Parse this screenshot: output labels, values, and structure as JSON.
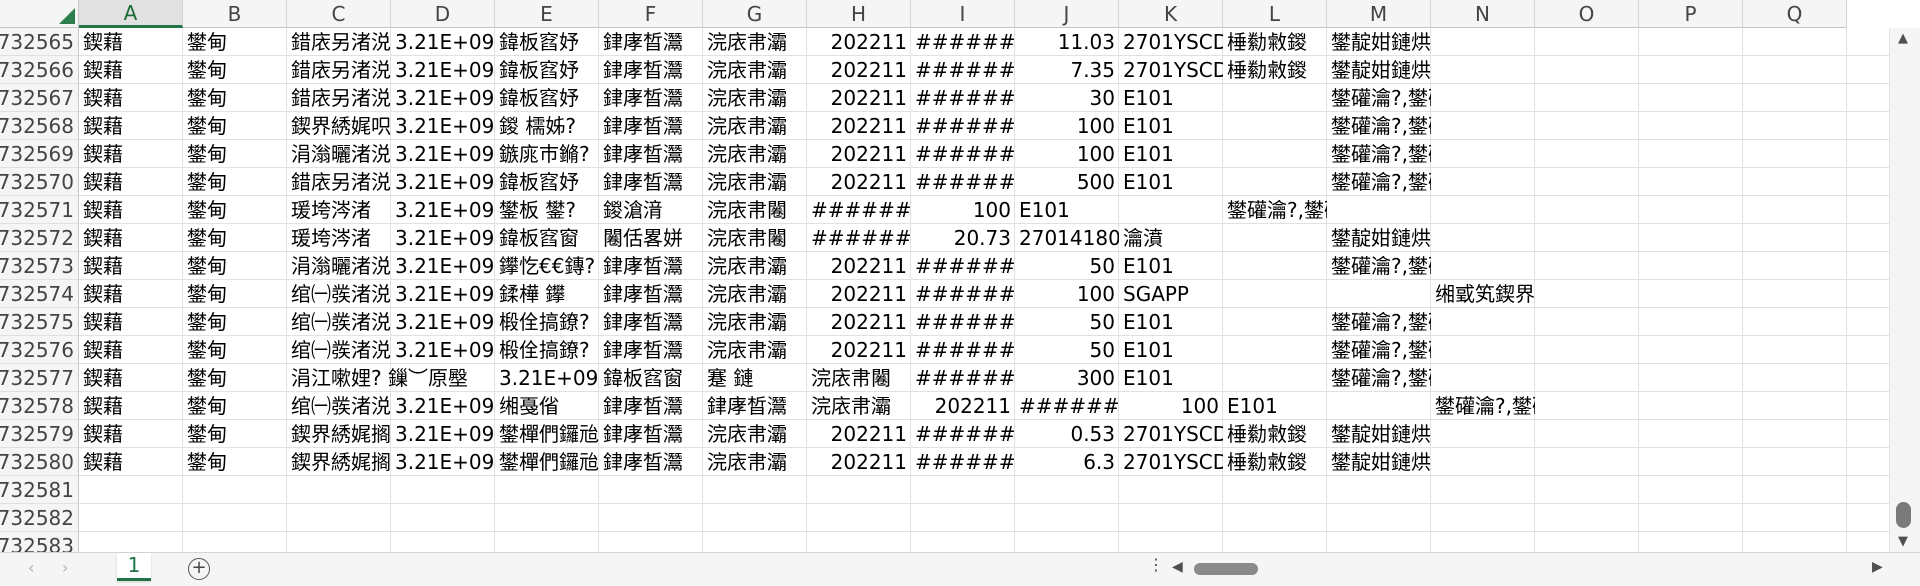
{
  "sheet": {
    "columns": [
      "A",
      "B",
      "C",
      "D",
      "E",
      "F",
      "G",
      "H",
      "I",
      "J",
      "K",
      "L",
      "M",
      "N",
      "O",
      "P",
      "Q"
    ],
    "selected_column": "A",
    "row_numbers": [
      "732565",
      "732566",
      "732567",
      "732568",
      "732569",
      "732570",
      "732571",
      "732572",
      "732573",
      "732574",
      "732575",
      "732576",
      "732577",
      "732578",
      "732579",
      "732580",
      "732581",
      "732582",
      "732583"
    ],
    "rows": [
      [
        {
          "col": "A",
          "v": "鍥藉"
        },
        {
          "col": "B",
          "v": "鐢甸"
        },
        {
          "col": "C",
          "v": "錯庡另渚涚"
        },
        {
          "col": "D",
          "v": "3.21E+09",
          "a": "r"
        },
        {
          "col": "E",
          "v": "鍏板窞妤"
        },
        {
          "col": "F",
          "v": "銉庨晳灊"
        },
        {
          "col": "G",
          "v": "浣庡帇灞"
        },
        {
          "col": "H",
          "v": "202211",
          "a": "r"
        },
        {
          "col": "I",
          "v": "#######"
        },
        {
          "col": "J",
          "v": "11.03",
          "a": "r"
        },
        {
          "col": "K",
          "v": "2701YSCD"
        },
        {
          "col": "L",
          "v": "棰勬敹鍐"
        },
        {
          "col": "M",
          "v": "鐢靛姏鏈烘澧炲€煎"
        }
      ],
      [
        {
          "col": "A",
          "v": "鍥藉"
        },
        {
          "col": "B",
          "v": "鐢甸"
        },
        {
          "col": "C",
          "v": "錯庡另渚涚"
        },
        {
          "col": "D",
          "v": "3.21E+09",
          "a": "r"
        },
        {
          "col": "E",
          "v": "鍏板窞妤"
        },
        {
          "col": "F",
          "v": "銉庨晳灊"
        },
        {
          "col": "G",
          "v": "浣庡帇灞"
        },
        {
          "col": "H",
          "v": "202211",
          "a": "r"
        },
        {
          "col": "I",
          "v": "#######"
        },
        {
          "col": "J",
          "v": "7.35",
          "a": "r"
        },
        {
          "col": "K",
          "v": "2701YSCD"
        },
        {
          "col": "L",
          "v": "棰勬敹鍐"
        },
        {
          "col": "M",
          "v": "鐢靛姏鏈烘澧炲€煎"
        }
      ],
      [
        {
          "col": "A",
          "v": "鍥藉"
        },
        {
          "col": "B",
          "v": "鐢甸"
        },
        {
          "col": "C",
          "v": "錯庡另渚涚"
        },
        {
          "col": "D",
          "v": "3.21E+09",
          "a": "r"
        },
        {
          "col": "E",
          "v": "鍏板窞妤"
        },
        {
          "col": "F",
          "v": "銉庨晳灊"
        },
        {
          "col": "G",
          "v": "浣庡帇灞"
        },
        {
          "col": "H",
          "v": "202211",
          "a": "r"
        },
        {
          "col": "I",
          "v": "#######"
        },
        {
          "col": "J",
          "v": "30",
          "a": "r"
        },
        {
          "col": "K",
          "v": "E101"
        },
        {
          "col": "M",
          "v": "鐢礶瀹?,鐢礶瀹?寰    俊\""
        }
      ],
      [
        {
          "col": "A",
          "v": "鍥藉"
        },
        {
          "col": "B",
          "v": "鐢甸"
        },
        {
          "col": "C",
          "v": "鍥界綉娓呮"
        },
        {
          "col": "D",
          "v": "3.21E+09",
          "a": "r"
        },
        {
          "col": "E",
          "v": "鍐    檽姊?"
        },
        {
          "col": "F",
          "v": "銉庨晳灊"
        },
        {
          "col": "G",
          "v": "浣庡帇灞"
        },
        {
          "col": "H",
          "v": "202211",
          "a": "r"
        },
        {
          "col": "I",
          "v": "#######"
        },
        {
          "col": "J",
          "v": "100",
          "a": "r"
        },
        {
          "col": "K",
          "v": "E101"
        },
        {
          "col": "M",
          "v": "鐢礶瀹?,鐢礶瀹?寰    俊\""
        }
      ],
      [
        {
          "col": "A",
          "v": "鍥藉"
        },
        {
          "col": "B",
          "v": "鐢甸"
        },
        {
          "col": "C",
          "v": "涓滃曬渚涚"
        },
        {
          "col": "D",
          "v": "3.21E+09",
          "a": "r"
        },
        {
          "col": "E",
          "v": "鏃庣巿鏅?"
        },
        {
          "col": "F",
          "v": "銉庨晳灊"
        },
        {
          "col": "G",
          "v": "浣庡帇灞"
        },
        {
          "col": "H",
          "v": "202211",
          "a": "r"
        },
        {
          "col": "I",
          "v": "#######"
        },
        {
          "col": "J",
          "v": "100",
          "a": "r"
        },
        {
          "col": "K",
          "v": "E101"
        },
        {
          "col": "M",
          "v": "鐢礶瀹?,鐢礶瀹?寰    俊\""
        }
      ],
      [
        {
          "col": "A",
          "v": "鍥藉"
        },
        {
          "col": "B",
          "v": "鐢甸"
        },
        {
          "col": "C",
          "v": "錯庡另渚涚"
        },
        {
          "col": "D",
          "v": "3.21E+09",
          "a": "r"
        },
        {
          "col": "E",
          "v": "鍏板窞妤"
        },
        {
          "col": "F",
          "v": "銉庨晳灊"
        },
        {
          "col": "G",
          "v": "浣庡帇灞"
        },
        {
          "col": "H",
          "v": "202211",
          "a": "r"
        },
        {
          "col": "I",
          "v": "#######"
        },
        {
          "col": "J",
          "v": "500",
          "a": "r"
        },
        {
          "col": "K",
          "v": "E101"
        },
        {
          "col": "M",
          "v": "鐢礶瀹?,鐢礶瀹?寰    俊\""
        }
      ],
      [
        {
          "col": "A",
          "v": "鍥藉"
        },
        {
          "col": "B",
          "v": "鐢甸"
        },
        {
          "col": "C",
          "v": "瑗垮涔渚"
        },
        {
          "col": "D",
          "v": "3.21E+09",
          "a": "r"
        },
        {
          "col": "E",
          "v": "鐢板    鐢?"
        },
        {
          "col": "F",
          "v": "鍐滄湇"
        },
        {
          "col": "G",
          "v": "浣庡帇闂"
        },
        {
          "col": "H",
          "v": "#######"
        },
        {
          "col": "I",
          "v": "100",
          "a": "r"
        },
        {
          "col": "J",
          "v": "E101"
        },
        {
          "col": "L",
          "v": "鐢礶瀹?,鐢礶瀹?寰    俊\""
        }
      ],
      [
        {
          "col": "A",
          "v": "鍥藉"
        },
        {
          "col": "B",
          "v": "鐢甸"
        },
        {
          "col": "C",
          "v": "瑗垮涔渚"
        },
        {
          "col": "D",
          "v": "3.21E+09",
          "a": "r"
        },
        {
          "col": "E",
          "v": "鍏板窞窗"
        },
        {
          "col": "F",
          "v": "闂佸畧姘"
        },
        {
          "col": "G",
          "v": "浣庡帇闂"
        },
        {
          "col": "H",
          "v": "#######"
        },
        {
          "col": "I",
          "v": "20.73",
          "a": "r"
        },
        {
          "col": "J",
          "v": "27014180"
        },
        {
          "col": "K",
          "v": "瀹濆"
        },
        {
          "col": "M",
          "v": "鐢靛姏鏈烘澧炲€煎"
        }
      ],
      [
        {
          "col": "A",
          "v": "鍥藉"
        },
        {
          "col": "B",
          "v": "鐢甸"
        },
        {
          "col": "C",
          "v": "涓滃曬渚涚"
        },
        {
          "col": "D",
          "v": "3.21E+09",
          "a": "r"
        },
        {
          "col": "E",
          "v": "鑻忔€€鏄?"
        },
        {
          "col": "F",
          "v": "銉庨晳灊"
        },
        {
          "col": "G",
          "v": "浣庡帇灞"
        },
        {
          "col": "H",
          "v": "202211",
          "a": "r"
        },
        {
          "col": "I",
          "v": "#######"
        },
        {
          "col": "J",
          "v": "50",
          "a": "r"
        },
        {
          "col": "K",
          "v": "E101"
        },
        {
          "col": "M",
          "v": "鐢礶瀹?,鐢礶瀹?寰    俊\""
        }
      ],
      [
        {
          "col": "A",
          "v": "鍥藉"
        },
        {
          "col": "B",
          "v": "鐢甸"
        },
        {
          "col": "C",
          "v": "绾㈠彂渚涚"
        },
        {
          "col": "D",
          "v": "3.21E+09",
          "a": "r"
        },
        {
          "col": "E",
          "v": "鍒樺    鑻"
        },
        {
          "col": "F",
          "v": "銉庨晳灊"
        },
        {
          "col": "G",
          "v": "浣庡帇灞"
        },
        {
          "col": "H",
          "v": "202211",
          "a": "r"
        },
        {
          "col": "I",
          "v": "#######"
        },
        {
          "col": "J",
          "v": "100",
          "a": "r"
        },
        {
          "col": "K",
          "v": "SGAPP"
        },
        {
          "col": "N",
          "v": "缃戜笂鍥界綉"
        }
      ],
      [
        {
          "col": "A",
          "v": "鍥藉"
        },
        {
          "col": "B",
          "v": "鐢甸"
        },
        {
          "col": "C",
          "v": "绾㈠彂渚涚"
        },
        {
          "col": "D",
          "v": "3.21E+09",
          "a": "r"
        },
        {
          "col": "E",
          "v": "椴佺搞鐐?"
        },
        {
          "col": "F",
          "v": "銉庨晳灊"
        },
        {
          "col": "G",
          "v": "浣庡帇灞"
        },
        {
          "col": "H",
          "v": "202211",
          "a": "r"
        },
        {
          "col": "I",
          "v": "#######"
        },
        {
          "col": "J",
          "v": "50",
          "a": "r"
        },
        {
          "col": "K",
          "v": "E101"
        },
        {
          "col": "M",
          "v": "鐢礶瀹?,鐢礶瀹?寰    俊\""
        }
      ],
      [
        {
          "col": "A",
          "v": "鍥藉"
        },
        {
          "col": "B",
          "v": "鐢甸"
        },
        {
          "col": "C",
          "v": "绾㈠彂渚涚"
        },
        {
          "col": "D",
          "v": "3.21E+09",
          "a": "r"
        },
        {
          "col": "E",
          "v": "椴佺搞鐐?"
        },
        {
          "col": "F",
          "v": "銉庨晳灊"
        },
        {
          "col": "G",
          "v": "浣庡帇灞"
        },
        {
          "col": "H",
          "v": "202211",
          "a": "r"
        },
        {
          "col": "I",
          "v": "#######"
        },
        {
          "col": "J",
          "v": "50",
          "a": "r"
        },
        {
          "col": "K",
          "v": "E101"
        },
        {
          "col": "M",
          "v": "鐢礶瀹?,鐢礶瀹?寰    俊\""
        }
      ],
      [
        {
          "col": "A",
          "v": "鍥藉"
        },
        {
          "col": "B",
          "v": "鐢甸"
        },
        {
          "col": "C",
          "v": "涓江嗽娌? 鏁︶原壂",
          "s": true
        },
        {
          "col": "E",
          "v": "3.21E+09",
          "a": "r"
        },
        {
          "col": "F",
          "v": "鍏板窞窗"
        },
        {
          "col": "G",
          "v": "蹇    鏈"
        },
        {
          "col": "H",
          "v": "浣庡帇闂"
        },
        {
          "col": "I",
          "v": "#######"
        },
        {
          "col": "J",
          "v": "300",
          "a": "r"
        },
        {
          "col": "K",
          "v": "E101"
        },
        {
          "col": "M",
          "v": "鐢礶瀹?,鐢礶瀹濈即璐?"
        }
      ],
      [
        {
          "col": "A",
          "v": "鍥藉"
        },
        {
          "col": "B",
          "v": "鐢甸"
        },
        {
          "col": "C",
          "v": "绾㈠彂渚涚"
        },
        {
          "col": "D",
          "v": "3.21E+09",
          "a": "r"
        },
        {
          "col": "E",
          "v": "缃戞偗"
        },
        {
          "col": "F",
          "v": "銉庨晳灊"
        },
        {
          "col": "G",
          "v": "銉庨晳灊"
        },
        {
          "col": "H",
          "v": "浣庡帇灞"
        },
        {
          "col": "I",
          "v": "202211",
          "a": "r"
        },
        {
          "col": "J",
          "v": "#######"
        },
        {
          "col": "K",
          "v": "100",
          "a": "r"
        },
        {
          "col": "L",
          "v": "E101"
        },
        {
          "col": "N",
          "v": "鐢礶瀹?,鐢礶瀹濇    鍏朵唬鎵?"
        }
      ],
      [
        {
          "col": "A",
          "v": "鍥藉"
        },
        {
          "col": "B",
          "v": "鐢甸"
        },
        {
          "col": "C",
          "v": "鍥界綉娓搁"
        },
        {
          "col": "D",
          "v": "3.21E+09",
          "a": "r"
        },
        {
          "col": "E",
          "v": "鐢樿們鑼兘"
        },
        {
          "col": "F",
          "v": "銉庨晳灊"
        },
        {
          "col": "G",
          "v": "浣庡帇灞"
        },
        {
          "col": "H",
          "v": "202211",
          "a": "r"
        },
        {
          "col": "I",
          "v": "#######"
        },
        {
          "col": "J",
          "v": "0.53",
          "a": "r"
        },
        {
          "col": "K",
          "v": "2701YSCD"
        },
        {
          "col": "L",
          "v": "棰勬敹鍐"
        },
        {
          "col": "M",
          "v": "鐢靛姏鏈烘澧炲€煎"
        }
      ],
      [
        {
          "col": "A",
          "v": "鍥藉"
        },
        {
          "col": "B",
          "v": "鐢甸"
        },
        {
          "col": "C",
          "v": "鍥界綉娓搁"
        },
        {
          "col": "D",
          "v": "3.21E+09",
          "a": "r"
        },
        {
          "col": "E",
          "v": "鐢樿們鑼兘"
        },
        {
          "col": "F",
          "v": "銉庨晳灊"
        },
        {
          "col": "G",
          "v": "浣庡帇灞"
        },
        {
          "col": "H",
          "v": "202211",
          "a": "r"
        },
        {
          "col": "I",
          "v": "#######"
        },
        {
          "col": "J",
          "v": "6.3",
          "a": "r"
        },
        {
          "col": "K",
          "v": "2701YSCD"
        },
        {
          "col": "L",
          "v": "棰勬敹鍐"
        },
        {
          "col": "M",
          "v": "鐢靛姏鏈烘澧炲€煎"
        }
      ]
    ]
  },
  "tabs": [
    {
      "label": "1"
    }
  ],
  "add_sheet_label": "+",
  "scroll_dots": "⋮",
  "colors": {
    "accent": "#217346",
    "header_bg": "#f5f5f5",
    "grid": "#e1e1e1"
  }
}
